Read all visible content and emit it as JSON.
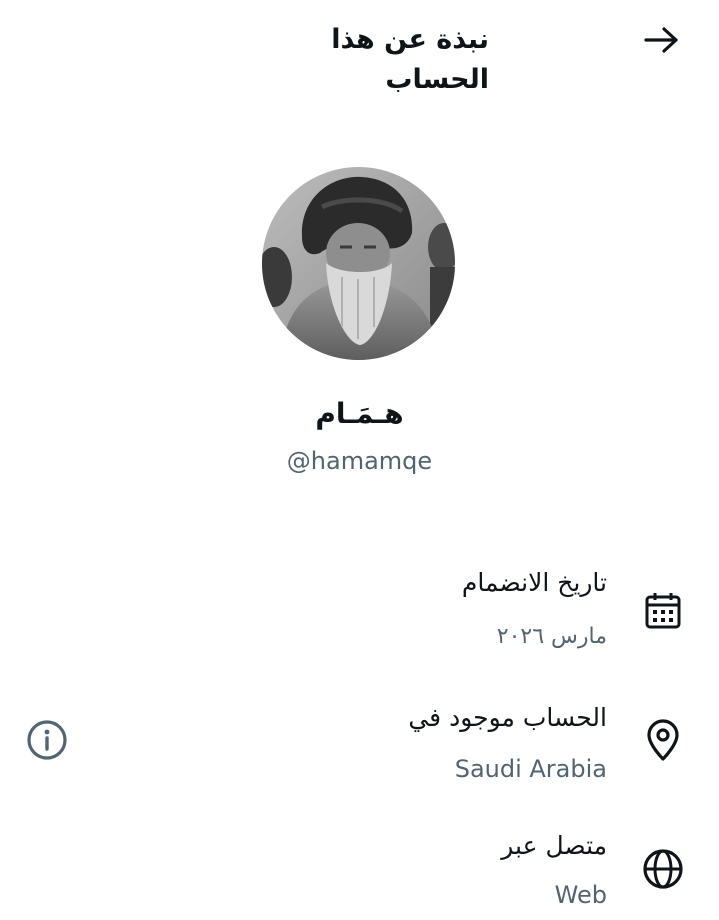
{
  "header": {
    "title": "نبذة عن هذا الحساب",
    "back_icon": "arrow-right-icon"
  },
  "profile": {
    "avatar_icon": "profile-photo",
    "display_name": "هـمَـام",
    "handle": "@hamamqe"
  },
  "details": {
    "joined": {
      "icon": "calendar-icon",
      "title": "تاريخ الانضمام",
      "value": "مارس ٢٠٢٦"
    },
    "location": {
      "icon": "location-pin-icon",
      "title": "الحساب موجود في",
      "value": "Saudi Arabia",
      "info_icon": "info-icon"
    },
    "connected": {
      "icon": "globe-icon",
      "title": "متصل عبر",
      "value": "Web"
    }
  },
  "colors": {
    "text_primary": "#0f1419",
    "text_secondary": "#536471",
    "background": "#ffffff"
  }
}
